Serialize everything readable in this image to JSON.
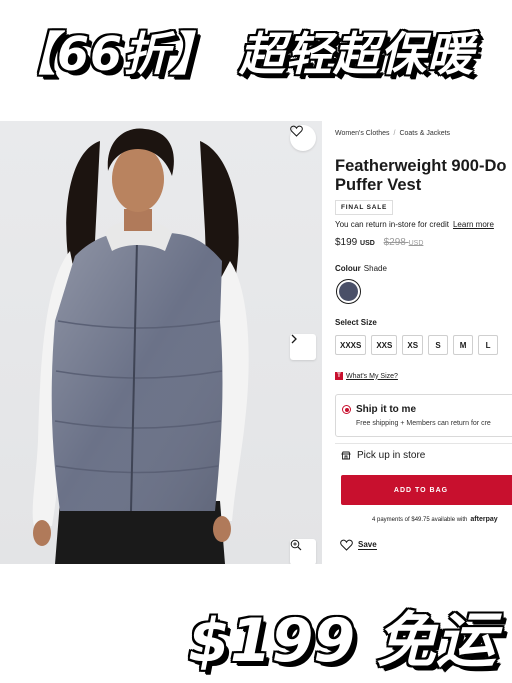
{
  "promo": {
    "top_left": "【66折】",
    "top_right": "超轻超保暖",
    "bottom": "$199 免运"
  },
  "breadcrumb": [
    "Women's Clothes",
    "Coats & Jackets"
  ],
  "product": {
    "title_line1": "Featherweight 900-Do",
    "title_line2": "Puffer Vest",
    "badge": "FINAL SALE",
    "return_note": "You can return in-store for credit",
    "learn_more": "Learn more",
    "price": "$199",
    "price_currency": "USD",
    "old_price": "$298",
    "old_currency": "USD"
  },
  "colour": {
    "label": "Colour",
    "value": "Shade",
    "swatch_color": "#4a5068"
  },
  "size": {
    "label": "Select Size",
    "options": [
      "XXXS",
      "XXS",
      "XS",
      "S",
      "M",
      "L"
    ],
    "guide_icon": "T",
    "guide_link": "What's My Size?"
  },
  "shipping": {
    "title": "Ship it to me",
    "subtitle": "Free shipping + Members can return for cre",
    "pickup": "Pick up in store"
  },
  "cart": {
    "add_label": "ADD TO BAG",
    "afterpay_text": "4 payments of $49.75 available with",
    "afterpay_brand": "afterpay"
  },
  "save": {
    "label": "Save"
  },
  "colors": {
    "accent": "#c8102e",
    "vest": "#6b7288"
  }
}
